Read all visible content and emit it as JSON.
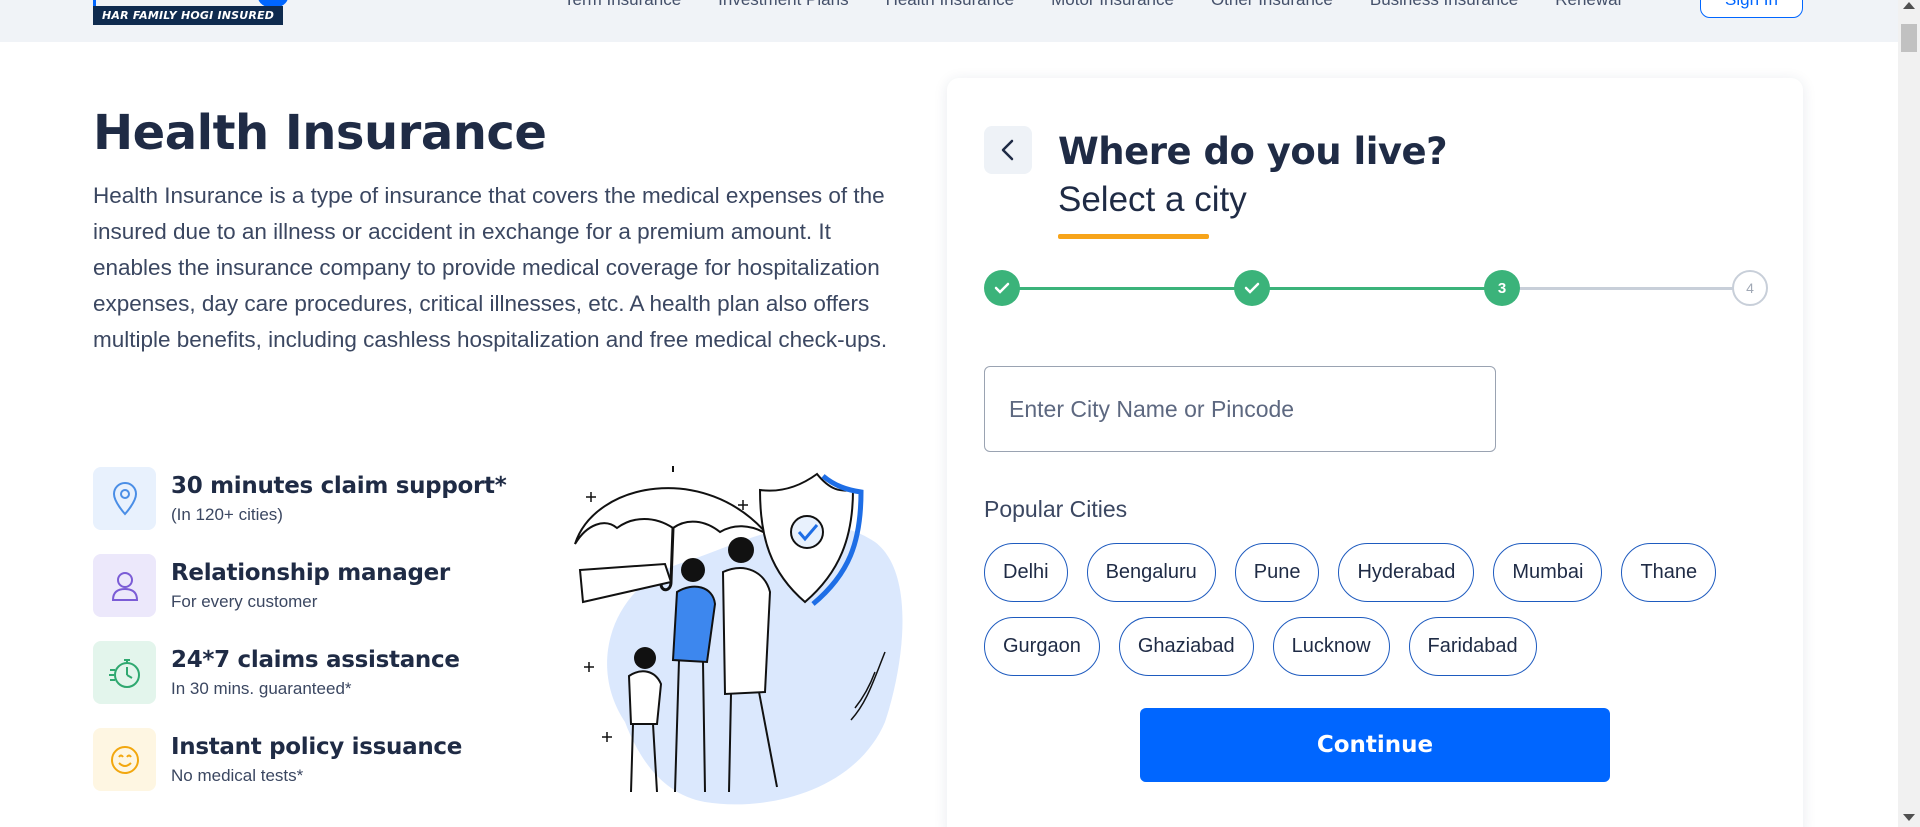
{
  "header": {
    "logo_tagline": "HAR FAMILY HOGI INSURED",
    "nav_items": [
      "Term Insurance",
      "Investment Plans",
      "Health Insurance",
      "Motor Insurance",
      "Other Insurance",
      "Business Insurance",
      "Renewal"
    ],
    "signin_label": "Sign In"
  },
  "main": {
    "title": "Health Insurance",
    "description": "Health Insurance is a type of insurance that covers the medical expenses of the insured due to an illness or accident in exchange for a premium amount. It enables the insurance company to provide medical coverage for hospitalization expenses, day care procedures, critical illnesses, etc. A health plan also offers multiple benefits, including cashless hospitalization and free medical check-ups.",
    "features": [
      {
        "title": "30 minutes claim support*",
        "subtitle": "(In 120+ cities)",
        "icon": "location-pin-icon",
        "bg": "#e8f1fd",
        "color": "#4a8ee6"
      },
      {
        "title": "Relationship manager",
        "subtitle": "For every customer",
        "icon": "person-icon",
        "bg": "#ece8fb",
        "color": "#7b5cd6"
      },
      {
        "title": "24*7 claims assistance",
        "subtitle": "In 30 mins. guaranteed*",
        "icon": "stopwatch-icon",
        "bg": "#e3f5ec",
        "color": "#2fa870"
      },
      {
        "title": "Instant policy issuance",
        "subtitle": "No medical tests*",
        "icon": "smiley-icon",
        "bg": "#fef6e2",
        "color": "#f2a70f"
      }
    ]
  },
  "form": {
    "question": "Where do you live?",
    "subheading": "Select a city",
    "steps": [
      {
        "label": "",
        "status": "done"
      },
      {
        "label": "",
        "status": "done"
      },
      {
        "label": "3",
        "status": "current"
      },
      {
        "label": "4",
        "status": "todo"
      }
    ],
    "city_input": {
      "placeholder": "Enter City Name or Pincode",
      "value": ""
    },
    "popular_label": "Popular Cities",
    "cities": [
      "Delhi",
      "Bengaluru",
      "Pune",
      "Hyderabad",
      "Mumbai",
      "Thane",
      "Gurgaon",
      "Ghaziabad",
      "Lucknow",
      "Faridabad"
    ],
    "continue_label": "Continue"
  },
  "colors": {
    "brand_blue": "#0066ff",
    "step_green": "#3bb37a",
    "underline_orange": "#f7a41a",
    "navy_text": "#1f2b45"
  }
}
